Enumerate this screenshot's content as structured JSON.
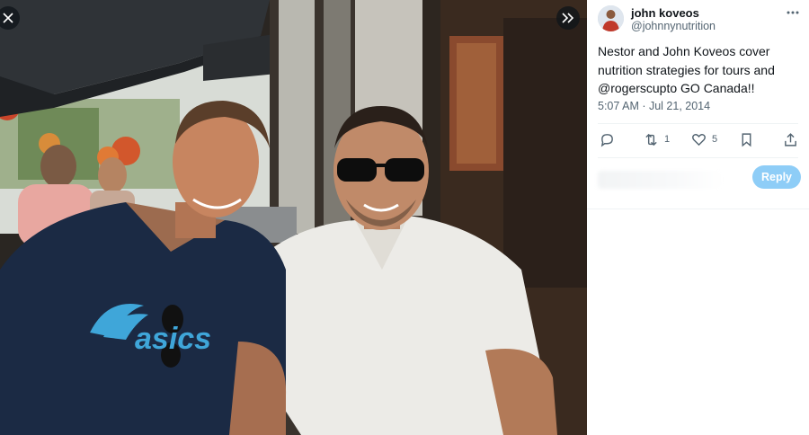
{
  "post": {
    "display_name": "john koveos",
    "handle": "@johnnynutrition",
    "text": "Nestor and John Koveos cover nutrition strategies for tours and @rogerscupto GO Canada!!",
    "timestamp": "5:07 AM · Jul 21, 2014"
  },
  "photo": {
    "shirt_logo_text": "asics"
  },
  "actions": {
    "reply_count": "",
    "retweet_count": "1",
    "like_count": "5"
  },
  "reply": {
    "button_label": "Reply"
  },
  "icons": {
    "close": "close-icon",
    "expand": "expand-icon",
    "more": "more-icon",
    "reply": "reply-icon",
    "retweet": "retweet-icon",
    "like": "heart-icon",
    "bookmark": "bookmark-icon",
    "share": "share-icon"
  },
  "colors": {
    "accent": "#1d9bf0",
    "reply_button_disabled": "#8ecdf7",
    "text_primary": "#0f1419",
    "text_secondary": "#536471"
  }
}
